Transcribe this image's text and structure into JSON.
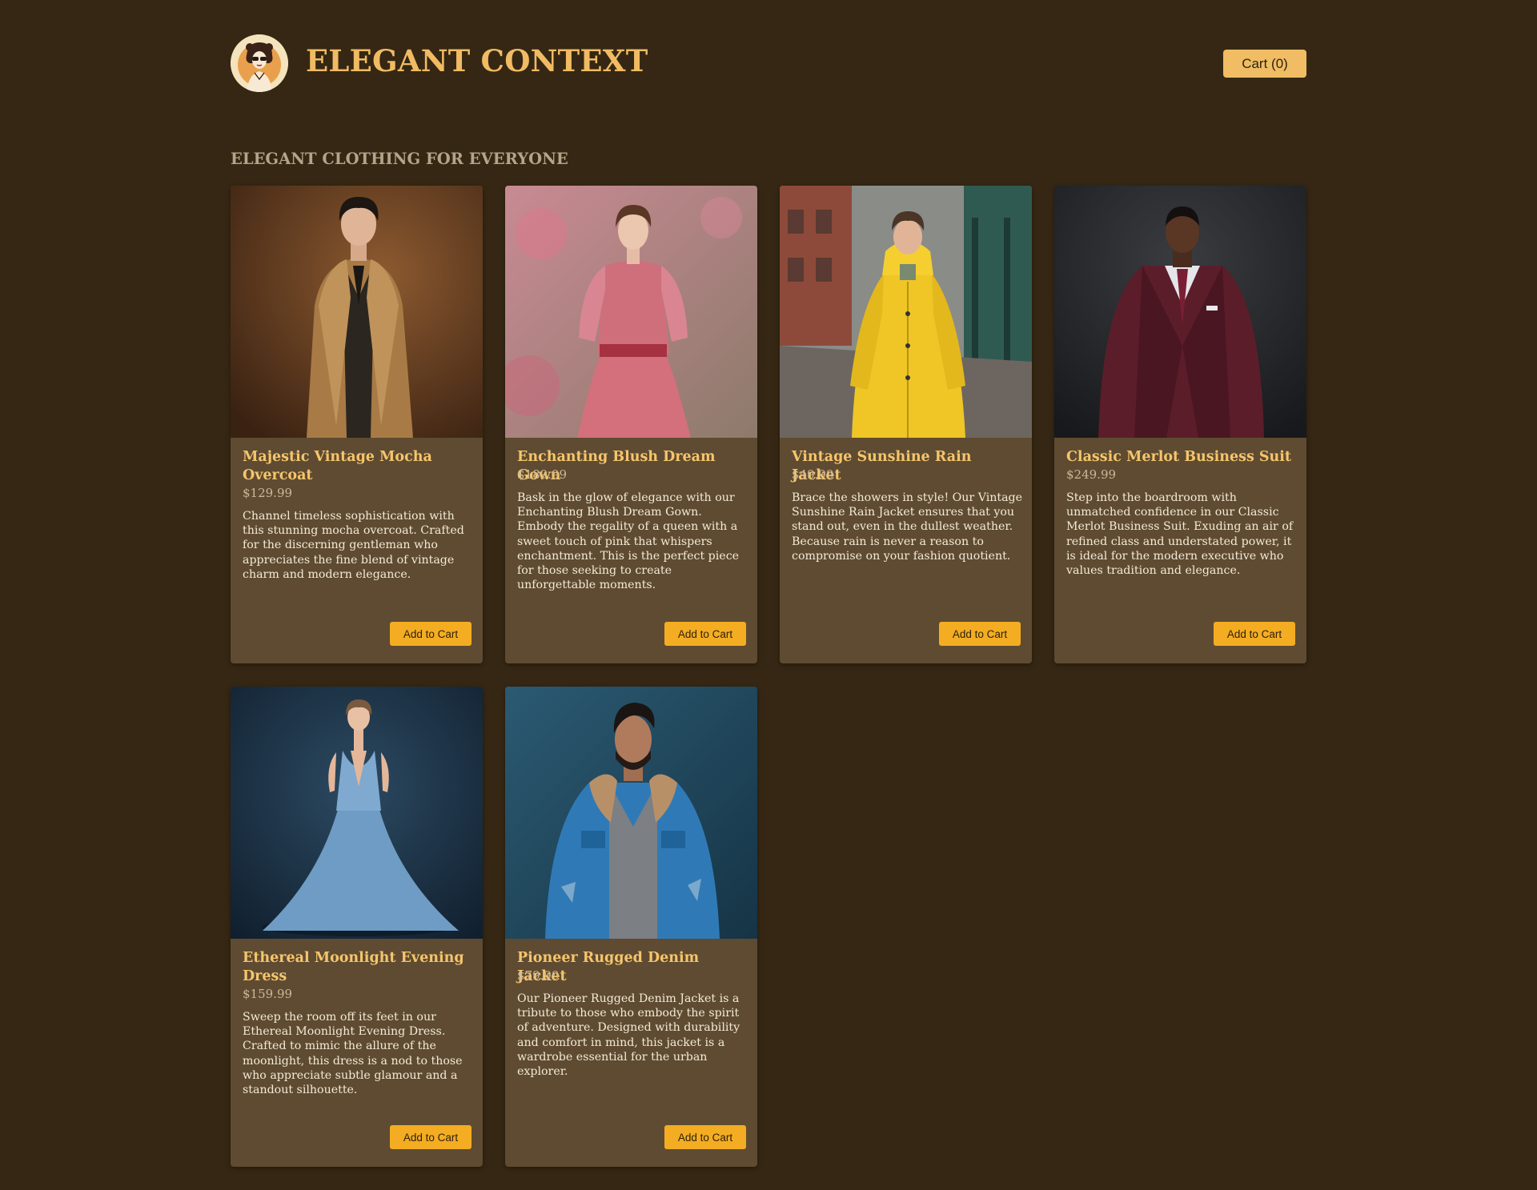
{
  "header": {
    "brand": "ELEGANT CONTEXT",
    "cart_label": "Cart (0)"
  },
  "tagline": "ELEGANT CLOTHING FOR EVERYONE",
  "colors": {
    "background": "#352713",
    "card": "#5e4b31",
    "accent": "#f1bb63",
    "button": "#f4ad22"
  },
  "products": [
    {
      "title": "Majestic Vintage Mocha Overcoat",
      "price": "$129.99",
      "description": "Channel timeless sophistication with this stunning mocha overcoat. Crafted for the discerning gentleman who appreciates the fine blend of vintage charm and modern elegance.",
      "button": "Add to Cart",
      "image": "man in mocha trench overcoat"
    },
    {
      "title": "Enchanting Blush Dream Gown",
      "price": "$189.99",
      "description": "Bask in the glow of elegance with our Enchanting Blush Dream Gown. Embody the regality of a queen with a sweet touch of pink that whispers enchantment. This is the perfect piece for those seeking to create unforgettable moments.",
      "button": "Add to Cart",
      "image": "woman in pink blush gown"
    },
    {
      "title": "Vintage Sunshine Rain Jacket",
      "price": "$49.99",
      "description": "Brace the showers in style! Our Vintage Sunshine Rain Jacket ensures that you stand out, even in the dullest weather. Because rain is never a reason to compromise on your fashion quotient.",
      "button": "Add to Cart",
      "image": "man in yellow rain jacket on street"
    },
    {
      "title": "Classic Merlot Business Suit",
      "price": "$249.99",
      "description": "Step into the boardroom with unmatched confidence in our Classic Merlot Business Suit. Exuding an air of refined class and understated power, it is ideal for the modern executive who values tradition and elegance.",
      "button": "Add to Cart",
      "image": "man in merlot business suit"
    },
    {
      "title": "Ethereal Moonlight Evening Dress",
      "price": "$159.99",
      "description": "Sweep the room off its feet in our Ethereal Moonlight Evening Dress. Crafted to mimic the allure of the moonlight, this dress is a nod to those who appreciate subtle glamour and a standout silhouette.",
      "button": "Add to Cart",
      "image": "woman in light blue evening dress"
    },
    {
      "title": "Pioneer Rugged Denim Jacket",
      "price": "$79.99",
      "description": "Our Pioneer Rugged Denim Jacket is a tribute to those who embody the spirit of adventure. Designed with durability and comfort in mind, this jacket is a wardrobe essential for the urban explorer.",
      "button": "Add to Cart",
      "image": "man in blue denim jacket"
    }
  ]
}
